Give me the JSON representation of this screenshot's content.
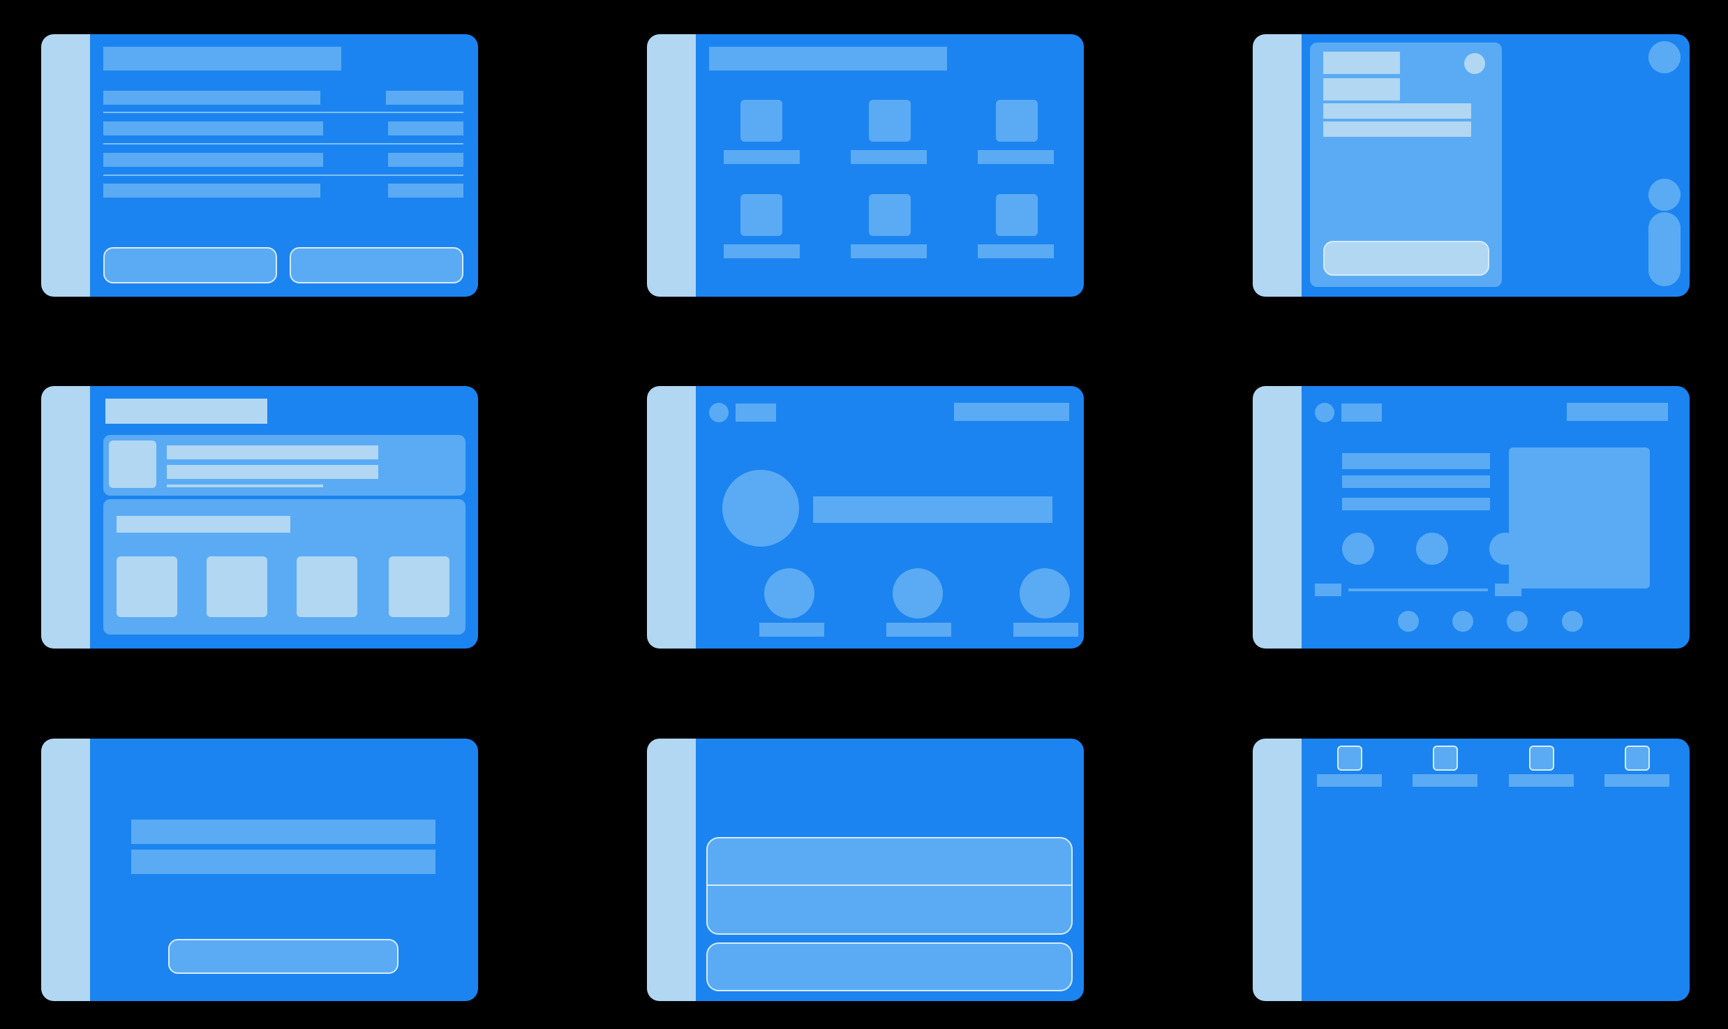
{
  "theme": {
    "background": "#000000",
    "panel": "#1c84f0",
    "rail": "#b1d7f3",
    "block": "#5aabf4",
    "block_light": "#b1d7f3",
    "outline": "#d7ebfb"
  },
  "wireframes": [
    {
      "id": "list-with-two-buttons"
    },
    {
      "id": "icon-grid"
    },
    {
      "id": "modal-dialog"
    },
    {
      "id": "card-gallery"
    },
    {
      "id": "profile-avatars"
    },
    {
      "id": "media-player"
    },
    {
      "id": "message-with-button"
    },
    {
      "id": "grouped-buttons-sheet"
    },
    {
      "id": "icon-toolbar"
    }
  ]
}
